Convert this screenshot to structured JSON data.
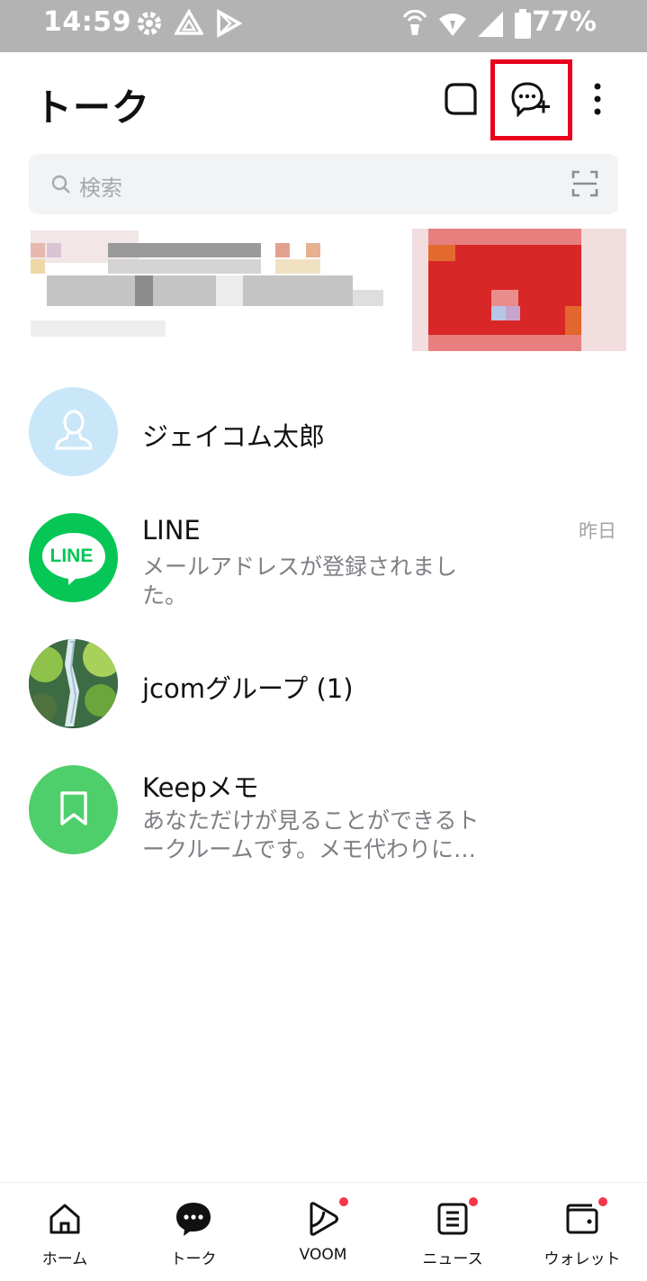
{
  "status_bar": {
    "time": "14:59",
    "battery": "77%",
    "left_icons": [
      "gear-icon",
      "triangle-app-icon",
      "play-store-icon"
    ],
    "right_icons": [
      "wifi-calling-icon",
      "wifi-icon",
      "signal-icon",
      "battery-icon"
    ]
  },
  "header": {
    "title": "トーク",
    "icons": [
      "square-icon",
      "new-chat-icon",
      "more-vertical-icon"
    ],
    "highlight_color": "#e8001c"
  },
  "search": {
    "placeholder": "検索",
    "icon": "search-icon",
    "right_icon": "scan-icon"
  },
  "chats": [
    {
      "name": "ジェイコム太郎",
      "preview": "",
      "time": "",
      "avatar": "person-icon"
    },
    {
      "name": "LINE",
      "preview": "メールアドレスが登録されました。",
      "time": "昨日",
      "avatar": "line-logo-icon",
      "avatar_text": "LINE"
    },
    {
      "name": "jcomグループ (1)",
      "preview": "",
      "time": "",
      "avatar": "waterfall-photo"
    },
    {
      "name": "Keepメモ",
      "preview": "あなただけが見ることができるトークルームです。メモ代わりに…",
      "time": "",
      "avatar": "bookmark-icon"
    }
  ],
  "bottom_nav": [
    {
      "label": "ホーム",
      "icon": "home-icon",
      "badge": false
    },
    {
      "label": "トーク",
      "icon": "chat-bubble-icon",
      "badge": false,
      "active": true
    },
    {
      "label": "VOOM",
      "icon": "voom-icon",
      "badge": true
    },
    {
      "label": "ニュース",
      "icon": "news-icon",
      "badge": true
    },
    {
      "label": "ウォレット",
      "icon": "wallet-icon",
      "badge": true
    }
  ],
  "colors": {
    "line_green": "#06c755",
    "keep_green": "#4fcf6b",
    "badge_red": "#f5364a",
    "status_bar": "#b3b3b3"
  }
}
